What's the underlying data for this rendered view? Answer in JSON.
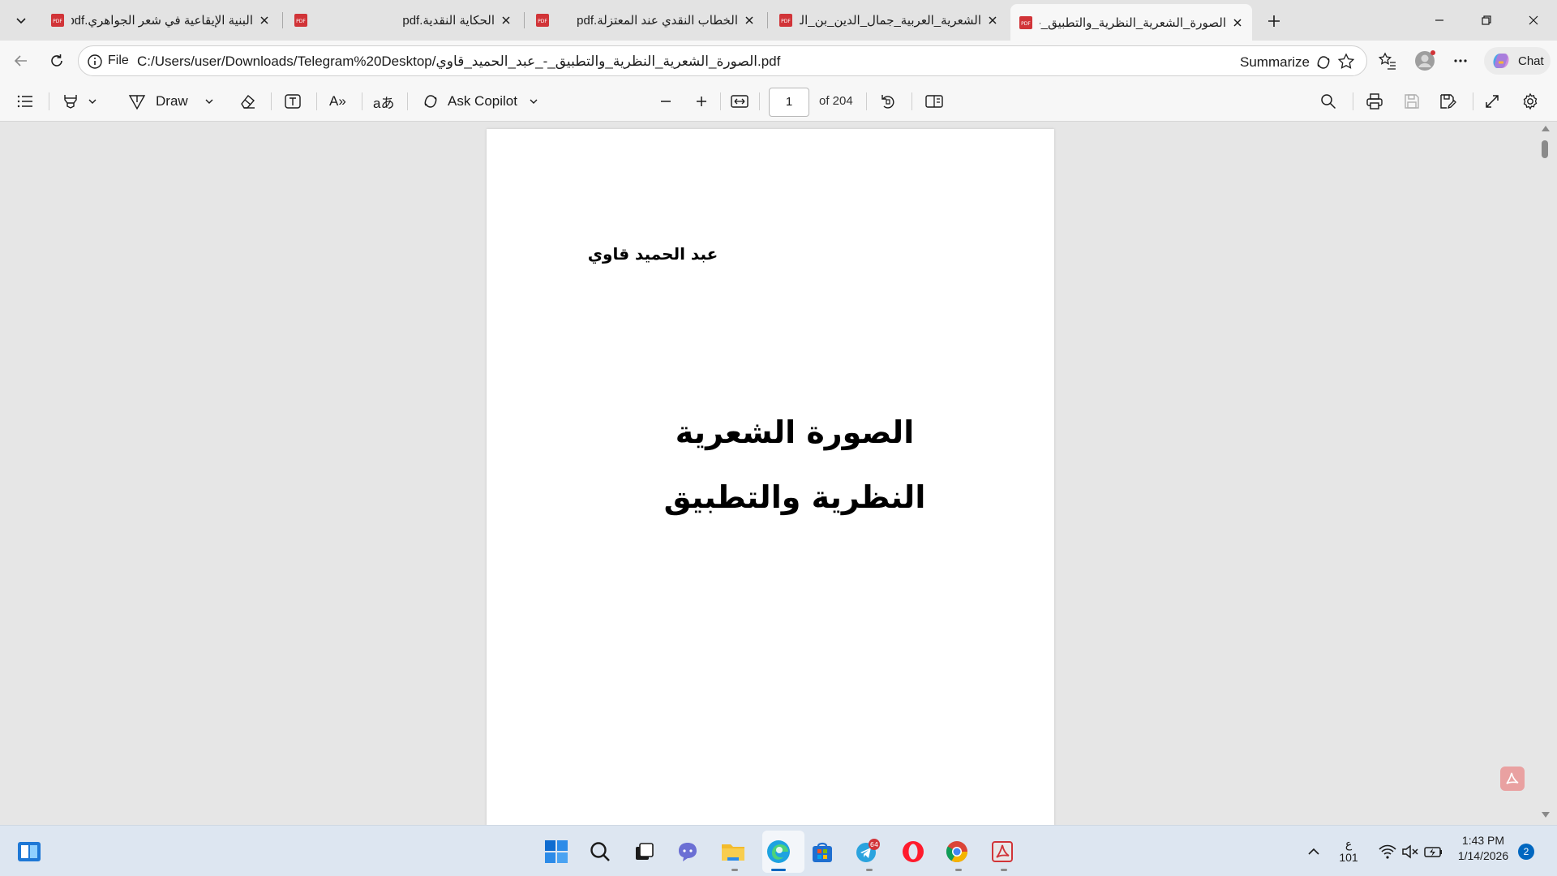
{
  "tabs": [
    {
      "title": "البنية الإيقاعية في شعر الجواهري.pdf",
      "active": false
    },
    {
      "title": "الحكاية النقدية.pdf",
      "active": false
    },
    {
      "title": "الخطاب النقدي عند المعتزلة.pdf",
      "active": false
    },
    {
      "title": "الشعرية_العربية_جمال_الدين_بن_الشي",
      "active": false
    },
    {
      "title": "الصورة_الشعرية_النظرية_والتطبيق_-_",
      "active": true
    }
  ],
  "address": {
    "file_label": "File",
    "url": "C:/Users/user/Downloads/Telegram%20Desktop/الصورة_الشعرية_النظرية_والتطبيق_-_عبد_الحميد_قاوي.pdf",
    "summarize_label": "Summarize",
    "chat_label": "Chat"
  },
  "toolbar": {
    "draw_label": "Draw",
    "ask_copilot_label": "Ask Copilot",
    "translate_glyph": "aあ",
    "read_aloud_glyph": "A»",
    "page_number": "1",
    "page_of": "of 204"
  },
  "document": {
    "author": "عبد الحميد قاوي",
    "title_line1": "الصورة الشعرية",
    "title_line2": "النظرية والتطبيق"
  },
  "taskbar": {
    "telegram_badge": "64",
    "lang_line1": "ع",
    "lang_line2": "101",
    "time": "1:43 PM",
    "date": "1/14/2026",
    "notification_count": "2"
  },
  "colors": {
    "accent": "#0067c0",
    "pdf_red": "#d13438",
    "tab_strip": "#e3e3e3",
    "toolbar": "#f7f7f7",
    "taskbar": "#dde6f1"
  }
}
